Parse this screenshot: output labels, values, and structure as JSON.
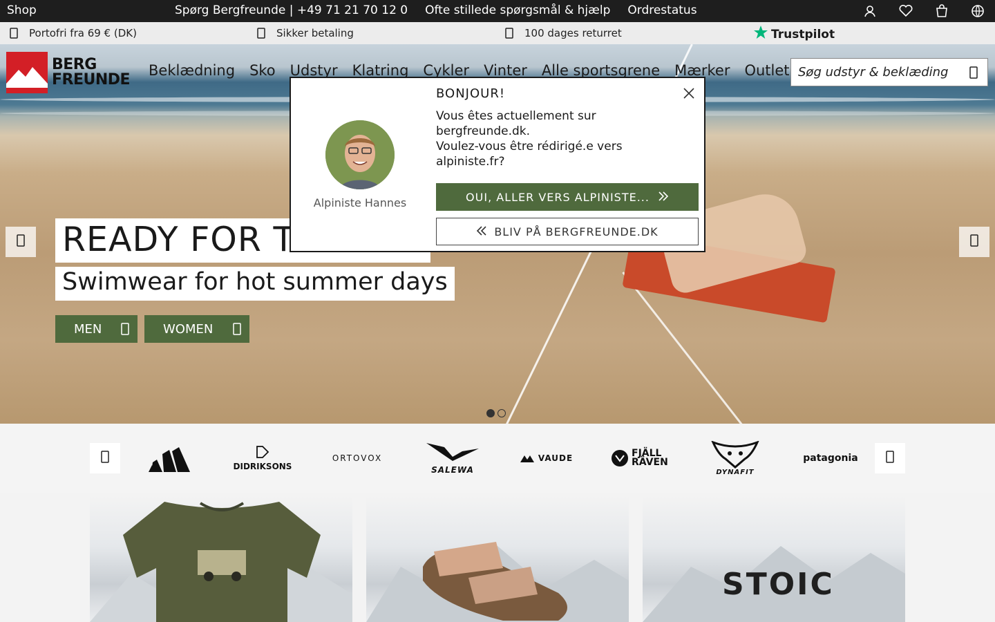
{
  "topbar": {
    "shop_label": "Shop",
    "links": [
      "Spørg Bergfreunde | +49 71 21 70 12 0",
      "Ofte stillede spørgsmål & hjælp",
      "Ordrestatus"
    ],
    "icons": [
      "user-icon",
      "heart-icon",
      "cart-icon",
      "globe-icon"
    ]
  },
  "usp": {
    "shipping": "Portofri fra 69 € (DK)",
    "payment": "Sikker betaling",
    "returns": "100 dages returret",
    "trustpilot": "Trustpilot"
  },
  "header": {
    "logo_line1": "BERG",
    "logo_line2": "FREUNDE",
    "nav": [
      "Beklædning",
      "Sko",
      "Udstyr",
      "Klatring",
      "Cykler",
      "Vinter",
      "Alle sportsgrene",
      "Mærker",
      "Outlet"
    ],
    "search_placeholder": "Søg udstyr & beklæding"
  },
  "hero": {
    "title": "READY FOR T",
    "subtitle": "Swimwear for hot summer days",
    "cta_men": "MEN",
    "cta_women": "WOMEN",
    "slides": 2,
    "active_slide": 1
  },
  "modal": {
    "title": "BONJOUR!",
    "message_line1": "Vous êtes actuellement sur bergfreunde.dk.",
    "message_line2": "Voulez-vous être rédirigé.e vers alpiniste.fr?",
    "avatar_name": "Alpiniste Hannes",
    "yes_label": "OUI, ALLER VERS ALPINISTE...",
    "stay_label": "BLIV PÅ BERGFREUNDE.DK"
  },
  "brands": [
    "adidas",
    "DIDRIKSONS",
    "ORTOVOX",
    "SALEWA",
    "VAUDE",
    "FJÄLL RÄVEN",
    "DYNAFIT",
    "patagonia"
  ],
  "tiles": {
    "stoic_label": "STOIC"
  },
  "colors": {
    "accent_green": "#4f6a3d",
    "brand_red": "#d31f26",
    "topbar": "#1e1e1e"
  }
}
